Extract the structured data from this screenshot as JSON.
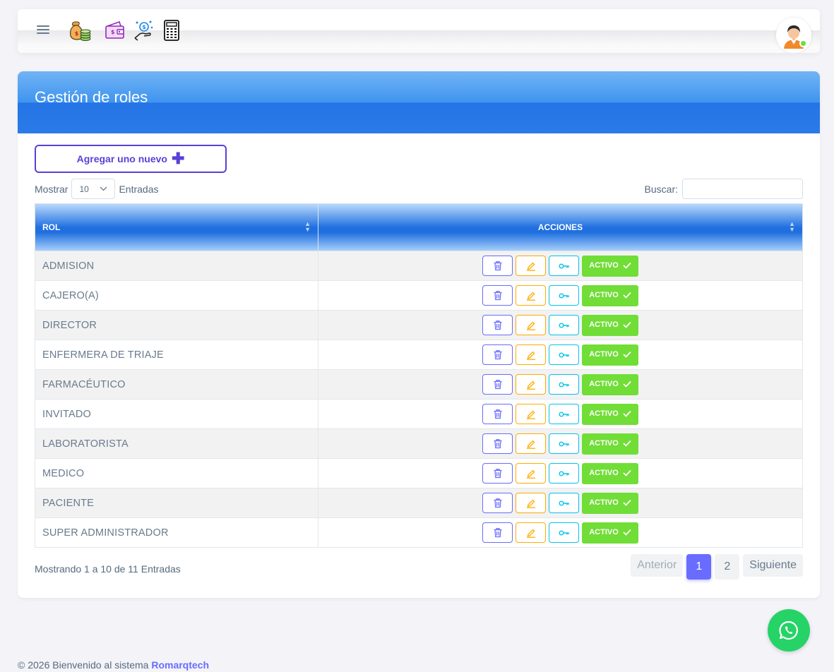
{
  "topbar": {
    "icons": [
      "money-bags-icon",
      "wallet-icon",
      "payment-hand-icon",
      "calculator-icon"
    ]
  },
  "page": {
    "title": "Gestión de roles"
  },
  "add_button": {
    "label": "Agregar uno nuevo",
    "icon": "plus-icon"
  },
  "length_menu": {
    "prefix": "Mostrar",
    "value": "10",
    "suffix": "Entradas"
  },
  "search": {
    "label": "Buscar:",
    "value": ""
  },
  "table": {
    "headers": [
      "ROL",
      "ACCIONES"
    ],
    "rows": [
      {
        "rol": "ADMISION",
        "status": "ACTIVO"
      },
      {
        "rol": "CAJERO(A)",
        "status": "ACTIVO"
      },
      {
        "rol": "DIRECTOR",
        "status": "ACTIVO"
      },
      {
        "rol": "ENFERMERA DE TRIAJE",
        "status": "ACTIVO"
      },
      {
        "rol": "FARMACÉUTICO",
        "status": "ACTIVO"
      },
      {
        "rol": "INVITADO",
        "status": "ACTIVO"
      },
      {
        "rol": "LABORATORISTA",
        "status": "ACTIVO"
      },
      {
        "rol": "MEDICO",
        "status": "ACTIVO"
      },
      {
        "rol": "PACIENTE",
        "status": "ACTIVO"
      },
      {
        "rol": "SUPER ADMINISTRADOR",
        "status": "ACTIVO"
      }
    ]
  },
  "info": "Mostrando 1 a 10 de 11 Entradas",
  "pagination": {
    "prev": "Anterior",
    "pages": [
      "1",
      "2"
    ],
    "current": "1",
    "next": "Siguiente"
  },
  "footer": {
    "text": "© 2026 Bienvenido al sistema",
    "brand": "Romarqtech"
  },
  "colors": {
    "primary": "#696cff",
    "warning": "#ffab00",
    "info": "#03c3ec",
    "success": "#71dd37",
    "header_blue": "#1f6fe0",
    "whatsapp": "#25d366"
  }
}
